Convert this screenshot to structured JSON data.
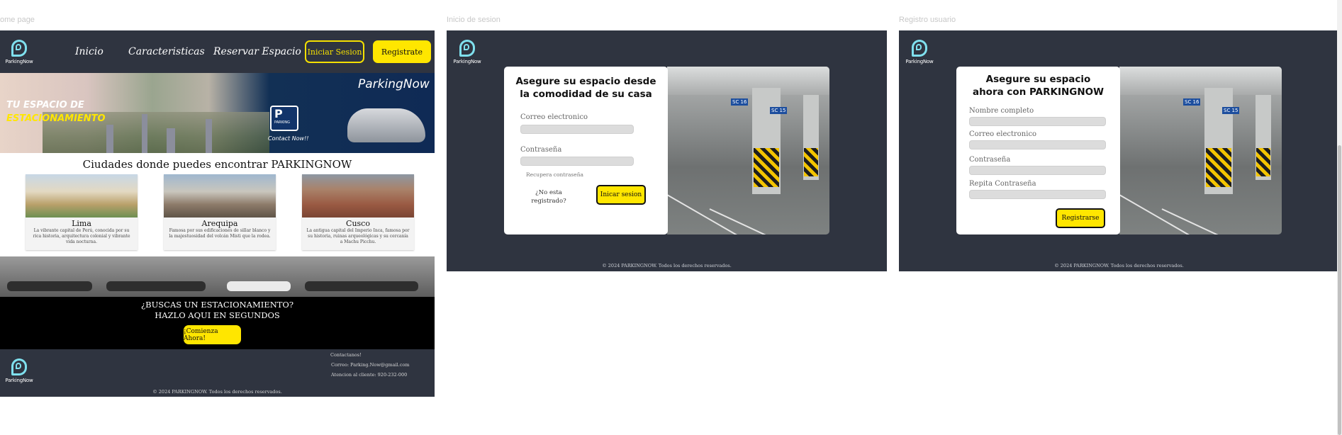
{
  "frames": {
    "home_label": "ome page",
    "login_label": "Inicio de sesion",
    "register_label": "Registro usuario"
  },
  "brand": {
    "logo_text": "ParkingNow",
    "accent_color": "#ffe600",
    "dark_color": "#2f3440",
    "logo_color": "#7fe0ee"
  },
  "home": {
    "nav": {
      "links": [
        "Inicio",
        "Caracteristicas",
        "Reservar Espacio"
      ],
      "login_button": "Iniciar Sesion",
      "register_button": "Registrate"
    },
    "hero": {
      "tagline_line1": "TU ESPACIO DE",
      "tagline_line2": "ESTACIONAMIENTO",
      "brand": "ParkingNow",
      "parking_sign": "P",
      "parking_sign_sub": "PARKING",
      "contact": "Contact Now!!"
    },
    "cities_title": "Ciudades donde puedes encontrar PARKINGNOW",
    "cities": [
      {
        "name": "Lima",
        "description": "La vibrante capital de Perú, conocida por su rica historia, arquitectura colonial y vibrante vida nocturna."
      },
      {
        "name": "Arequipa",
        "description": "Famosa por sus edificaciones de sillar blanco y la majestuosidad del volcán Misti que la rodea."
      },
      {
        "name": "Cusco",
        "description": "La antigua capital del Imperio Inca, famosa por su historia, ruinas arqueológicas y su cercanía a Machu Picchu."
      }
    ],
    "banner": {
      "line1": "¿BUSCAS UN ESTACIONAMIENTO?",
      "line2": "HAZLO AQUI EN SEGUNDOS",
      "cta": "¡Comienza Ahora!"
    },
    "footer": {
      "contact_title": "Contactanos!",
      "email": "Correo: Parking.Now@gmail.com",
      "phone": "Atencion al cliente: 920-232-000",
      "copyright": "© 2024 PARKINGNOW. Todos los derechos reservados."
    }
  },
  "login": {
    "title": "Asegure su espacio desde la comodidad de su casa",
    "email_label": "Correo electronico",
    "password_label": "Contraseña",
    "recover": "Recupera contraseña",
    "not_registered": "¿No esta registrado?",
    "submit": "Inicar sesion",
    "copyright": "© 2024 PARKINGNOW. Todos los derechos reservados.",
    "photo_signs": [
      "SC 16",
      "SC 15"
    ]
  },
  "register": {
    "title": "Asegure su espacio ahora con PARKINGNOW",
    "name_label": "Nombre completo",
    "email_label": "Correo electronico",
    "password_label": "Contraseña",
    "repeat_label": "Repita Contraseña",
    "submit": "Registrarse",
    "copyright": "© 2024 PARKINGNOW. Todos los derechos reservados.",
    "photo_signs": [
      "SC 16",
      "SC 15"
    ]
  }
}
